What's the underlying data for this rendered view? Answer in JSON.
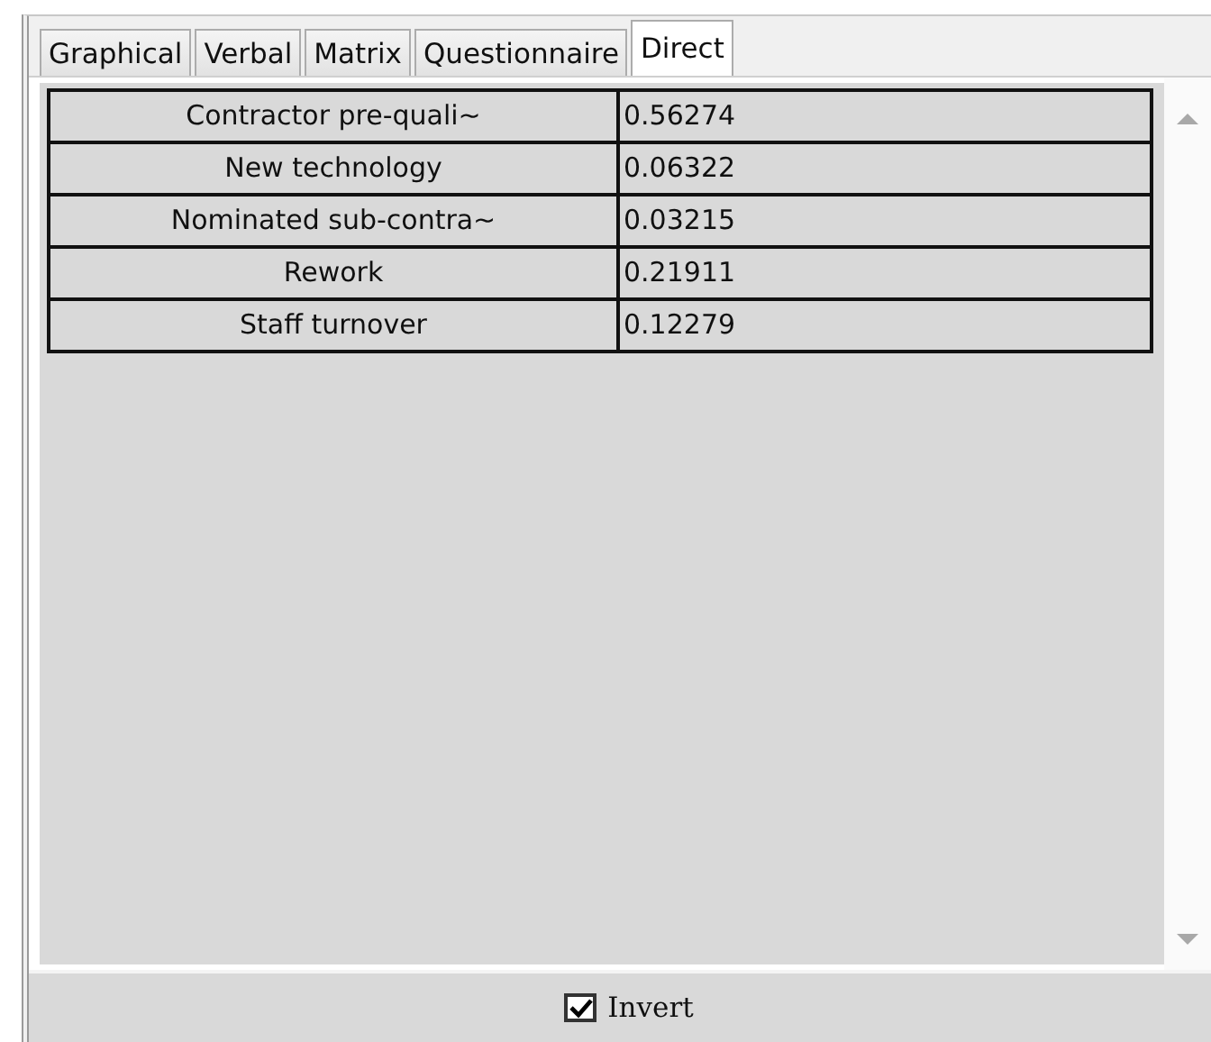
{
  "tabs": [
    {
      "label": "Graphical",
      "selected": false
    },
    {
      "label": "Verbal",
      "selected": false
    },
    {
      "label": "Matrix",
      "selected": false
    },
    {
      "label": "Questionnaire",
      "selected": false
    },
    {
      "label": "Direct",
      "selected": true
    }
  ],
  "table": {
    "rows": [
      {
        "name": "Contractor pre-quali~",
        "value": "0.56274"
      },
      {
        "name": "New technology",
        "value": "0.06322"
      },
      {
        "name": "Nominated sub-contra~",
        "value": "0.03215"
      },
      {
        "name": "Rework",
        "value": "0.21911"
      },
      {
        "name": "Staff turnover",
        "value": "0.12279"
      }
    ]
  },
  "invert": {
    "label": "Invert",
    "checked": true
  }
}
